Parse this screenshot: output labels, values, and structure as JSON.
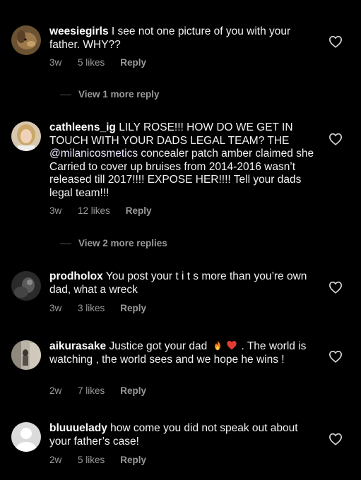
{
  "comments": [
    {
      "username": "weesiegirls",
      "text": " I see not one picture of you with your father. WHY??",
      "time": "3w",
      "likes": "5 likes",
      "reply": "Reply"
    },
    {
      "username": "cathleens_ig",
      "text_before": " LILY ROSE!!! HOW DO WE GET IN TOUCH WITH YOUR DADS LEGAL TEAM? THE ",
      "mention": "@milanicosmetics",
      "text_after": " concealer patch amber claimed she Carried to cover up bruises from 2014-2016 wasn’t released till 2017!!!! EXPOSE HER!!!! Tell your dads legal team!!!",
      "time": "3w",
      "likes": "12 likes",
      "reply": "Reply"
    },
    {
      "username": "prodholox",
      "text": " You post your t i t s more than you’re own dad, what a wreck",
      "time": "3w",
      "likes": "3 likes",
      "reply": "Reply"
    },
    {
      "username": "aikurasake",
      "text_before": " Justice got your dad ",
      "text_after": ". The world is watching , the world sees and we hope he wins !",
      "time": "2w",
      "likes": "7 likes",
      "reply": "Reply"
    },
    {
      "username": "bluuuelady",
      "text": " how come you did not speak out about your father’s case!",
      "time": "2w",
      "likes": "5 likes",
      "reply": "Reply"
    }
  ],
  "view_replies": [
    {
      "label": "View 1 more reply"
    },
    {
      "label": "View 2 more replies"
    }
  ],
  "icons": {
    "heart": "heart-outline-icon",
    "fire": "fire-emoji",
    "red_heart": "red-heart-emoji"
  },
  "colors": {
    "background": "#000000",
    "text": "#f2f2f2",
    "meta": "#9a9a9a"
  }
}
